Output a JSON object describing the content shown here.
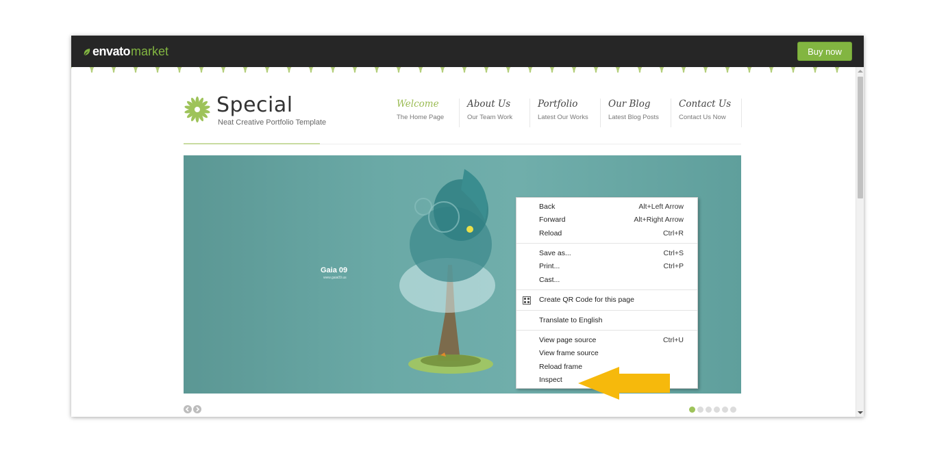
{
  "topbar": {
    "logo_envato": "envato",
    "logo_market": "market",
    "buy_label": "Buy now",
    "accent_color": "#82b541"
  },
  "site": {
    "brand_title": "Special",
    "brand_subtitle": "Neat Creative Portfolio Template",
    "nav": [
      {
        "title": "Welcome",
        "subtitle": "The Home Page",
        "active": true
      },
      {
        "title": "About Us",
        "subtitle": "Our Team Work",
        "active": false
      },
      {
        "title": "Portfolio",
        "subtitle": "Latest Our Works",
        "active": false
      },
      {
        "title": "Our Blog",
        "subtitle": "Latest Blog Posts",
        "active": false
      },
      {
        "title": "Contact Us",
        "subtitle": "Contact Us Now",
        "active": false
      }
    ],
    "hero": {
      "title": "Gaia 09",
      "url": "www.gaia09.us"
    },
    "slider_dots": 6,
    "active_dot": 1
  },
  "context_menu": {
    "groups": [
      [
        {
          "label": "Back",
          "shortcut": "Alt+Left Arrow"
        },
        {
          "label": "Forward",
          "shortcut": "Alt+Right Arrow"
        },
        {
          "label": "Reload",
          "shortcut": "Ctrl+R"
        }
      ],
      [
        {
          "label": "Save as...",
          "shortcut": "Ctrl+S"
        },
        {
          "label": "Print...",
          "shortcut": "Ctrl+P"
        },
        {
          "label": "Cast...",
          "shortcut": ""
        }
      ],
      [
        {
          "label": "Create QR Code for this page",
          "shortcut": "",
          "icon": "qr-code-icon"
        }
      ],
      [
        {
          "label": "Translate to English",
          "shortcut": ""
        }
      ],
      [
        {
          "label": "View page source",
          "shortcut": "Ctrl+U"
        },
        {
          "label": "View frame source",
          "shortcut": ""
        },
        {
          "label": "Reload frame",
          "shortcut": ""
        },
        {
          "label": "Inspect",
          "shortcut": ""
        }
      ]
    ]
  },
  "annotation": {
    "arrow_color": "#f6b90c",
    "icon": "left-arrow-icon"
  }
}
